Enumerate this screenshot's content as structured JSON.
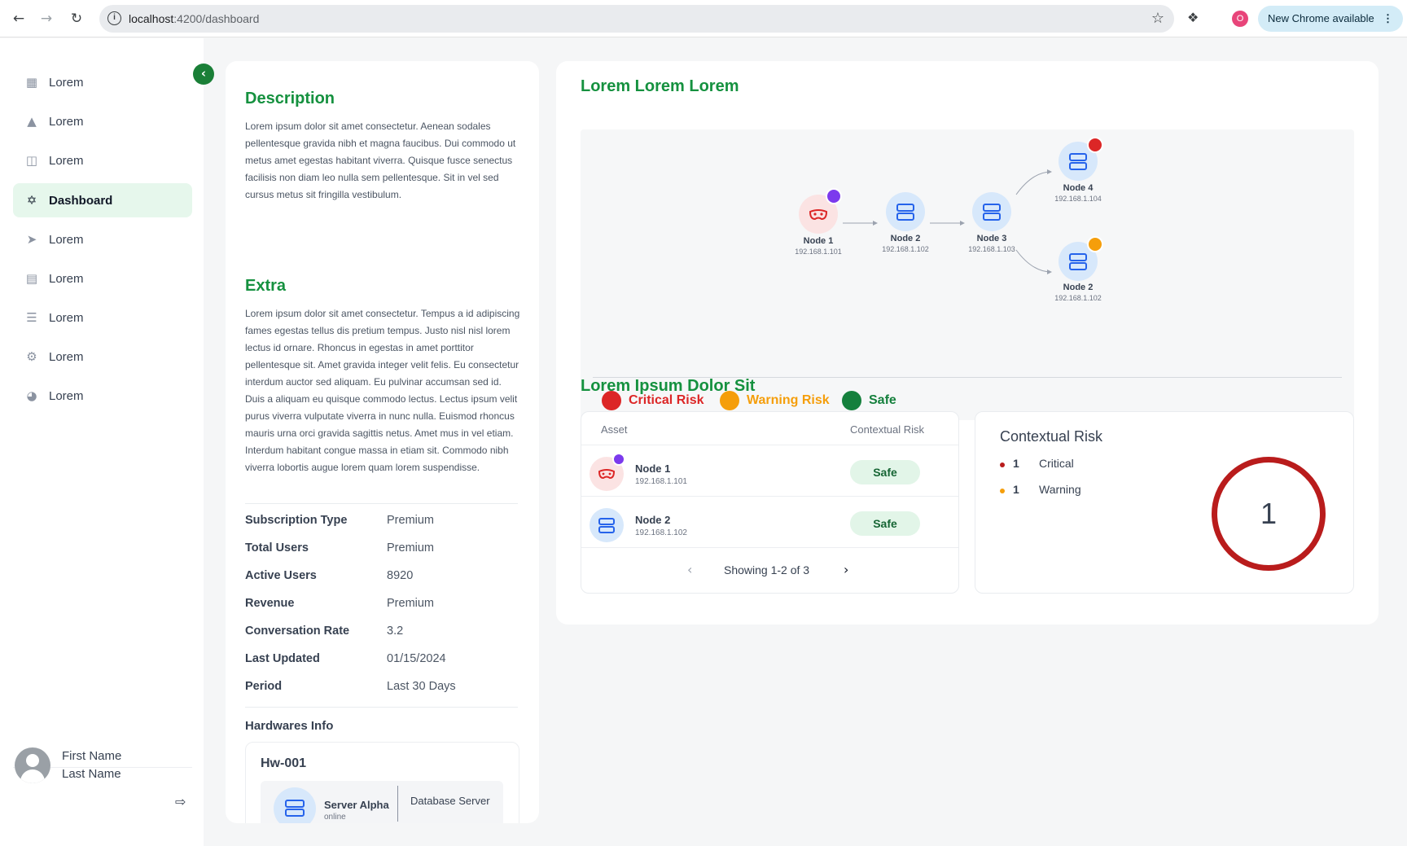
{
  "browser": {
    "url_host": "localhost",
    "url_path": ":4200/dashboard",
    "profile_initial": "O",
    "update_label": "New Chrome available"
  },
  "sidebar": {
    "items": [
      {
        "label": "Lorem",
        "icon": "grid-icon"
      },
      {
        "label": "Lorem",
        "icon": "warning-icon"
      },
      {
        "label": "Lorem",
        "icon": "stack-icon"
      },
      {
        "label": "Dashboard",
        "icon": "dashboard-icon",
        "active": true
      },
      {
        "label": "Lorem",
        "icon": "plug-icon"
      },
      {
        "label": "Lorem",
        "icon": "document-icon"
      },
      {
        "label": "Lorem",
        "icon": "tree-icon"
      },
      {
        "label": "Lorem",
        "icon": "gear-icon"
      },
      {
        "label": "Lorem",
        "icon": "chart-icon"
      }
    ],
    "user": {
      "first": "First Name",
      "last": "Last Name"
    }
  },
  "info": {
    "description_title": "Description",
    "description_text": "Lorem ipsum dolor sit amet consectetur. Aenean sodales pellentesque gravida nibh et magna faucibus. Dui commodo ut metus amet egestas habitant viverra. Quisque fusce senectus facilisis non diam leo nulla sem pellentesque. Sit in vel sed cursus metus sit fringilla vestibulum.",
    "extra_title": "Extra",
    "extra_text": "Lorem ipsum dolor sit amet consectetur. Tempus a id adipiscing fames egestas tellus dis pretium tempus. Justo nisl nisl lorem lectus id ornare. Rhoncus in egestas in amet porttitor pellentesque sit. Amet gravida integer velit felis. Eu consectetur interdum auctor sed aliquam. Eu pulvinar accumsan sed id. Duis a aliquam eu quisque commodo lectus. Lectus ipsum velit purus viverra vulputate viverra in nunc nulla. Euismod rhoncus mauris urna orci gravida sagittis netus. Amet mus in vel etiam. Interdum habitant congue massa in etiam sit. Commodo nibh viverra lobortis augue lorem quam lorem suspendisse.",
    "details": [
      {
        "key": "Subscription Type",
        "value": "Premium"
      },
      {
        "key": "Total Users",
        "value": "Premium"
      },
      {
        "key": "Active Users",
        "value": "8920"
      },
      {
        "key": "Revenue",
        "value": "Premium"
      },
      {
        "key": "Conversation Rate",
        "value": "3.2"
      },
      {
        "key": "Last Updated",
        "value": "01/15/2024"
      },
      {
        "key": "Period",
        "value": "Last 30 Days"
      }
    ],
    "hardware_title": "Hardwares Info",
    "hardware": {
      "id": "Hw-001",
      "name": "Server Alpha",
      "status": "online",
      "role": "Database Server"
    }
  },
  "main": {
    "title": "Lorem Lorem Lorem",
    "graph": {
      "nodes": [
        {
          "label": "Node 1",
          "ip": "192.168.1.101"
        },
        {
          "label": "Node 2",
          "ip": "192.168.1.102"
        },
        {
          "label": "Node 3",
          "ip": "192.168.1.103"
        },
        {
          "label": "Node 4",
          "ip": "192.168.1.104"
        },
        {
          "label": "Node 2",
          "ip": "192.168.1.102"
        }
      ],
      "legend": [
        {
          "label": "Critical Risk",
          "color": "#dc2626"
        },
        {
          "label": "Warning Risk",
          "color": "#f59e0b"
        },
        {
          "label": "Safe",
          "color": "#15803d"
        }
      ]
    },
    "subtitle": "Lorem Ipsum Dolor Sit",
    "table": {
      "col_asset": "Asset",
      "col_risk": "Contextual Risk",
      "rows": [
        {
          "name": "Node 1",
          "ip": "192.168.1.101",
          "risk": "Safe"
        },
        {
          "name": "Node 2",
          "ip": "192.168.1.102",
          "risk": "Safe"
        }
      ],
      "pager_text": "Showing 1-2 of 3"
    },
    "risk_card": {
      "title": "Contextual Risk",
      "items": [
        {
          "count": "1",
          "label": "Critical",
          "color": "#b91c1c"
        },
        {
          "count": "1",
          "label": "Warning",
          "color": "#f59e0b"
        }
      ],
      "total": "1"
    }
  }
}
